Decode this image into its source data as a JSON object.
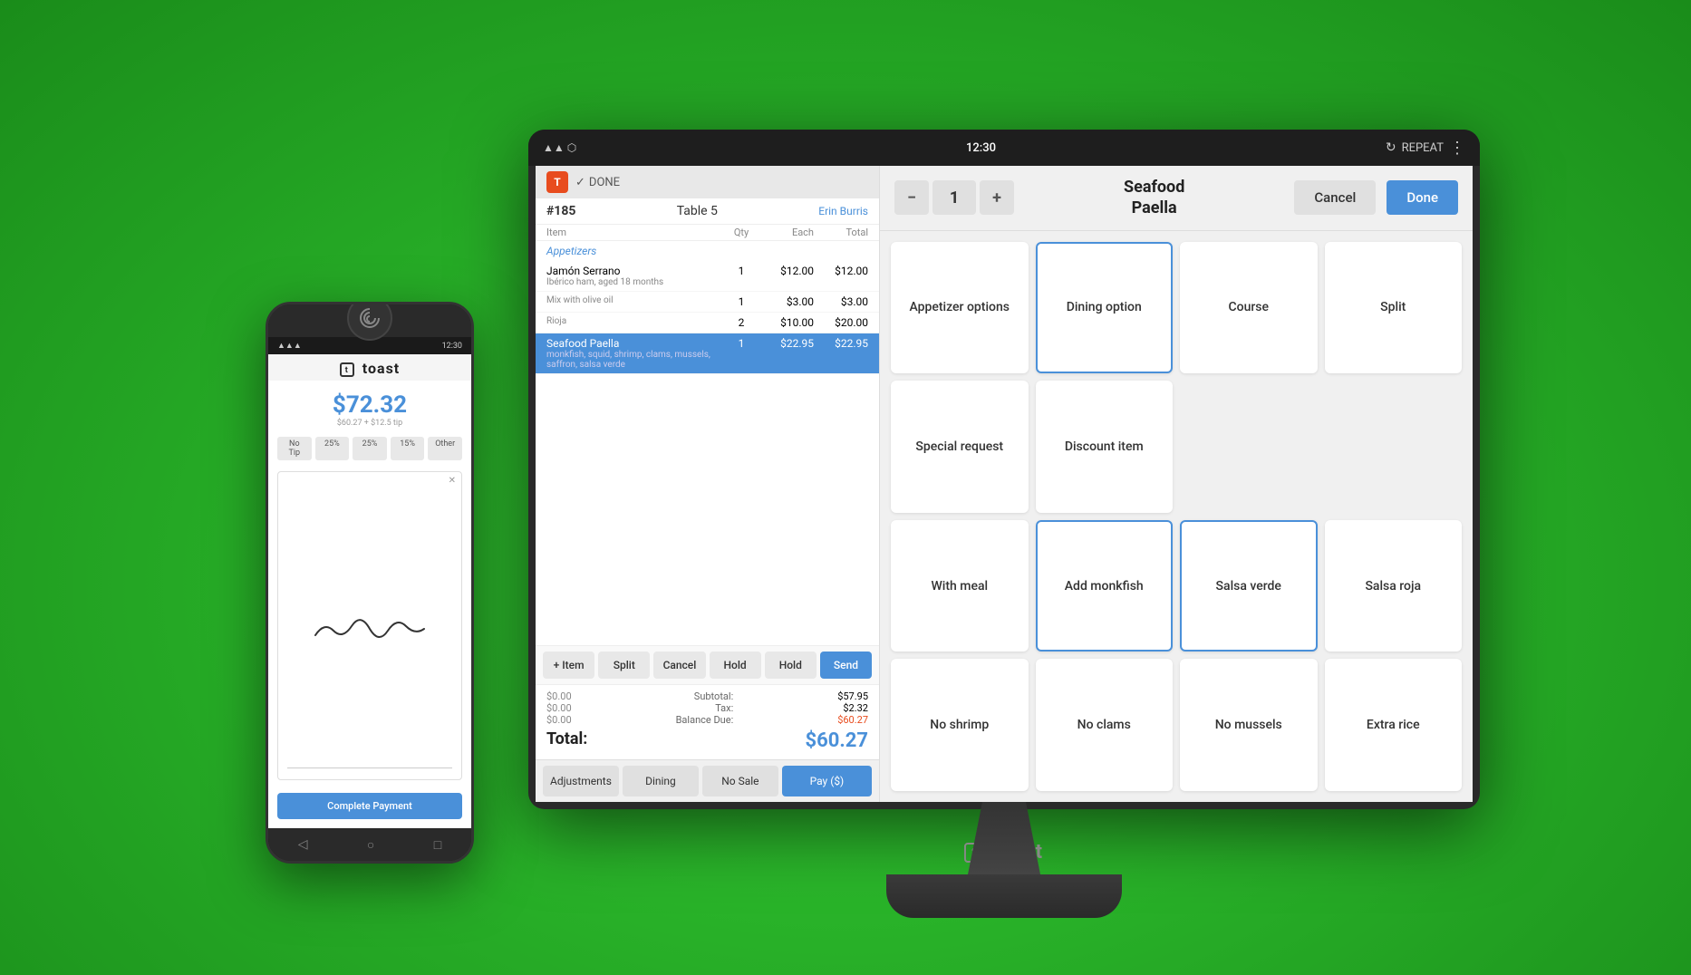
{
  "background": "#2db52d",
  "phone": {
    "brand": "toast",
    "status_bar": {
      "left": "",
      "signal": "▲▲▲",
      "wifi": "wifi",
      "time": "12:30"
    },
    "amount": "$72.32",
    "amount_sub": "$60.27 + $12.5 tip",
    "tip_options": [
      "No Tip",
      "25%",
      "25%",
      "15%",
      "Other"
    ],
    "complete_label": "Complete Payment",
    "nav": [
      "◁",
      "○",
      "□"
    ]
  },
  "monitor": {
    "status_bar": {
      "icons": "▲▲ ⬡",
      "time": "12:30",
      "repeat_label": "REPEAT",
      "more": "⋮"
    },
    "pos": {
      "order_number": "#185",
      "table": "Table 5",
      "server": "Erin Burris",
      "columns": {
        "item": "Item",
        "qty": "Qty",
        "each": "Each",
        "total": "Total"
      },
      "section_header": "Appetizers",
      "items": [
        {
          "name": "Jamón Serrano",
          "desc": "Ibérico ham, aged 18 months",
          "qty": "1",
          "each": "$12.00",
          "total": "$12.00",
          "active": false
        },
        {
          "name": "",
          "desc": "Mix with olive oil",
          "qty": "1",
          "each": "$3.00",
          "total": "$3.00",
          "active": false
        },
        {
          "name": "",
          "desc": "Rioja",
          "qty": "2",
          "each": "$10.00",
          "total": "$20.00",
          "active": false
        },
        {
          "name": "Seafood Paella",
          "desc": "monkfish, squid, shrimp, clams, mussels, saffron, salsa verde",
          "qty": "1",
          "each": "$22.95",
          "total": "$22.95",
          "active": true
        }
      ],
      "action_buttons": [
        "+ Item",
        "Split",
        "Cancel",
        "Hold",
        "Hold",
        "Send"
      ],
      "totals": {
        "subtotal_label": "Subtotal:",
        "subtotal_value": "$57.95",
        "tax_label": "Tax:",
        "tax_value": "$2.32",
        "balance_label": "Balance Due:",
        "balance_value": "$60.27",
        "total_label": "Total:",
        "total_value": "$60.27"
      },
      "bottom_buttons": [
        "Adjustments",
        "Dining",
        "No Sale",
        "Pay ($)"
      ]
    },
    "modifier": {
      "qty": "1",
      "item_name": "Seafood\nPaella",
      "cancel_label": "Cancel",
      "done_label": "Done",
      "cells": [
        {
          "label": "Appetizer options",
          "selected": false,
          "row": 1,
          "col": 1
        },
        {
          "label": "Dining option",
          "selected": true,
          "row": 1,
          "col": 2
        },
        {
          "label": "Course",
          "selected": false,
          "row": 1,
          "col": 3
        },
        {
          "label": "Split",
          "selected": false,
          "row": 1,
          "col": 4
        },
        {
          "label": "Special request",
          "selected": false,
          "row": 2,
          "col": 1
        },
        {
          "label": "Discount item",
          "selected": false,
          "row": 2,
          "col": 2
        },
        {
          "label": "",
          "selected": false,
          "row": 2,
          "col": 3,
          "empty": true
        },
        {
          "label": "",
          "selected": false,
          "row": 2,
          "col": 4,
          "empty": true
        },
        {
          "label": "With meal",
          "selected": false,
          "row": 3,
          "col": 1
        },
        {
          "label": "Add monkfish",
          "selected": true,
          "row": 3,
          "col": 2
        },
        {
          "label": "Salsa verde",
          "selected": true,
          "row": 3,
          "col": 3
        },
        {
          "label": "Salsa roja",
          "selected": false,
          "row": 3,
          "col": 4
        },
        {
          "label": "No shrimp",
          "selected": false,
          "row": 4,
          "col": 1
        },
        {
          "label": "No clams",
          "selected": false,
          "row": 4,
          "col": 2
        },
        {
          "label": "No mussels",
          "selected": false,
          "row": 4,
          "col": 3
        },
        {
          "label": "Extra rice",
          "selected": false,
          "row": 4,
          "col": 4
        }
      ]
    }
  }
}
